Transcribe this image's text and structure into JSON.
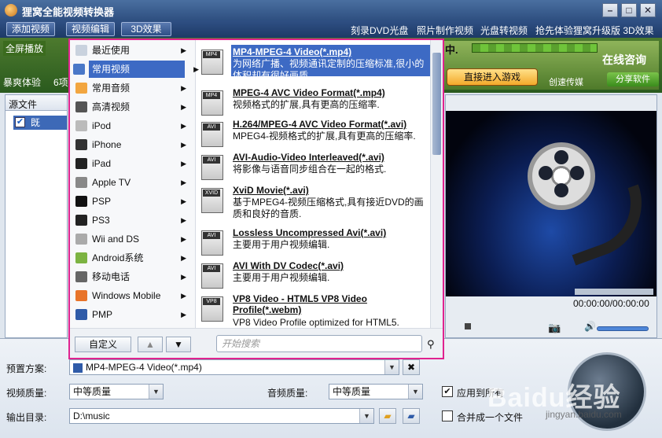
{
  "window": {
    "title": "狸窝全能视频转换器"
  },
  "toolbar": {
    "buttons": [
      "添加视频",
      "视频编辑",
      "3D效果"
    ],
    "links": [
      "刻录DVD光盘",
      "照片制作视频",
      "光盘转视频",
      "抢先体验狸窝升级版 3D效果"
    ]
  },
  "ad": {
    "fullscreen": "全屏播放",
    "text_bottom_left": "暴爽体验",
    "text_bottom_left2": "6项",
    "zhong": "中.",
    "game_button": "直接进入游戏",
    "chuangsu": "创速传媒",
    "online": "在线咨询",
    "share": "分享软件"
  },
  "file_panel": {
    "header": "源文件",
    "row_label": "既"
  },
  "preview": {
    "time": "00:00:00/00:00:00"
  },
  "categories": [
    {
      "label": "最近使用",
      "icon": "clock-icon",
      "color": "#c9d2de"
    },
    {
      "label": "常用视频",
      "icon": "clapper-icon",
      "color": "#4a78c8",
      "selected": true
    },
    {
      "label": "常用音频",
      "icon": "music-icon",
      "color": "#f2a640"
    },
    {
      "label": "高清视频",
      "icon": "film-icon",
      "color": "#555"
    },
    {
      "label": "iPod",
      "icon": "ipod-icon",
      "color": "#bbb"
    },
    {
      "label": "iPhone",
      "icon": "iphone-icon",
      "color": "#333"
    },
    {
      "label": "iPad",
      "icon": "ipad-icon",
      "color": "#222"
    },
    {
      "label": "Apple TV",
      "icon": "apple-icon",
      "color": "#888"
    },
    {
      "label": "PSP",
      "icon": "psp-icon",
      "color": "#111"
    },
    {
      "label": "PS3",
      "icon": "ps3-icon",
      "color": "#222"
    },
    {
      "label": "Wii and DS",
      "icon": "wii-icon",
      "color": "#aaa"
    },
    {
      "label": "Android系统",
      "icon": "android-icon",
      "color": "#7cb342"
    },
    {
      "label": "移动电话",
      "icon": "phone-icon",
      "color": "#666"
    },
    {
      "label": "Windows Mobile",
      "icon": "windows-icon",
      "color": "#e8742a"
    },
    {
      "label": "PMP",
      "icon": "pmp-icon",
      "color": "#2f5ba8"
    }
  ],
  "formats": [
    {
      "tag": "MP4",
      "title": "MP4-MPEG-4 Video(*.mp4)",
      "desc": "为网络广播、视频通讯定制的压缩标准,很小的体积却有很好画质.",
      "selected": true
    },
    {
      "tag": "MP4",
      "title": "MPEG-4 AVC Video Format(*.mp4)",
      "desc": "视频格式的扩展,具有更高的压缩率."
    },
    {
      "tag": "AVI",
      "title": "H.264/MPEG-4 AVC Video Format(*.avi)",
      "desc": "MPEG4-视频格式的扩展,具有更高的压缩率."
    },
    {
      "tag": "AVI",
      "title": "AVI-Audio-Video Interleaved(*.avi)",
      "desc": "将影像与语音同步组合在一起的格式."
    },
    {
      "tag": "XVID",
      "title": "XviD Movie(*.avi)",
      "desc": "基于MPEG4-视频压缩格式,具有接近DVD的画质和良好的音质."
    },
    {
      "tag": "AVI",
      "title": "Lossless Uncompressed Avi(*.avi)",
      "desc": "主要用于用户视频编辑."
    },
    {
      "tag": "AVI",
      "title": "AVI With DV Codec(*.avi)",
      "desc": "主要用于用户视频编辑."
    },
    {
      "tag": "VP8",
      "title": "VP8 Video - HTML5 VP8 Video Profile(*.webm)",
      "desc": "VP8 Video Profile optimized for HTML5."
    }
  ],
  "popup_footer": {
    "custom_button": "自定义",
    "search_placeholder": "开始搜索"
  },
  "bottom": {
    "preset_label": "预置方案:",
    "preset_value": "MP4-MPEG-4 Video(*.mp4)",
    "video_quality_label": "视频质量:",
    "video_quality_value": "中等质量",
    "audio_quality_label": "音频质量:",
    "audio_quality_value": "中等质量",
    "apply_all_label": "应用到所有",
    "output_label": "输出目录:",
    "output_value": "D:\\music",
    "merge_label": "合并成一个文件"
  },
  "watermark": {
    "text": "Baidu经验",
    "sub": "jingyan.baidu.com"
  }
}
